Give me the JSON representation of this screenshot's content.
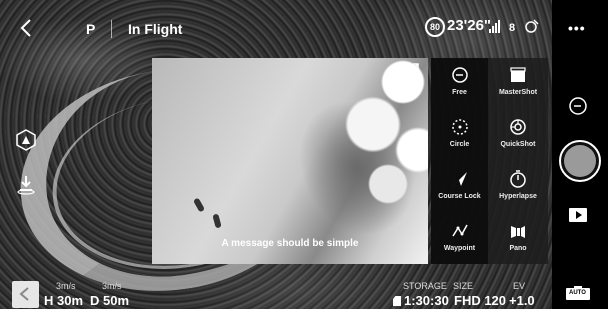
{
  "topbar": {
    "flight_mode": "P",
    "status": "In Flight",
    "battery": "80",
    "flight_time": "23'26\""
  },
  "video": {
    "caption": "A message should be simple"
  },
  "quickshot_menu": {
    "items": [
      {
        "label": "Free",
        "icon": "free-mode-icon"
      },
      {
        "label": "MasterShot",
        "icon": "mastershot-icon"
      },
      {
        "label": "Circle",
        "icon": "circle-icon"
      },
      {
        "label": "QuickShot",
        "icon": "quickshot-icon"
      },
      {
        "label": "Course Lock",
        "icon": "course-lock-icon"
      },
      {
        "label": "Hyperlapse",
        "icon": "hyperlapse-icon"
      },
      {
        "label": "Waypoint",
        "icon": "waypoint-icon"
      },
      {
        "label": "Pano",
        "icon": "pano-icon"
      }
    ]
  },
  "telemetry": {
    "horizontal_speed": "3m/s",
    "vertical_speed": "3m/s",
    "height": "H 30m",
    "distance": "D 50m"
  },
  "camera": {
    "storage_label": "STORAGE",
    "size_label": "SIZE",
    "ev_label": "EV",
    "storage_value": "1:30:30",
    "size_value": "FHD 120",
    "ev_value": "+1.0"
  },
  "sidebar": {
    "more": "•••",
    "auto_label": "AUTO"
  }
}
